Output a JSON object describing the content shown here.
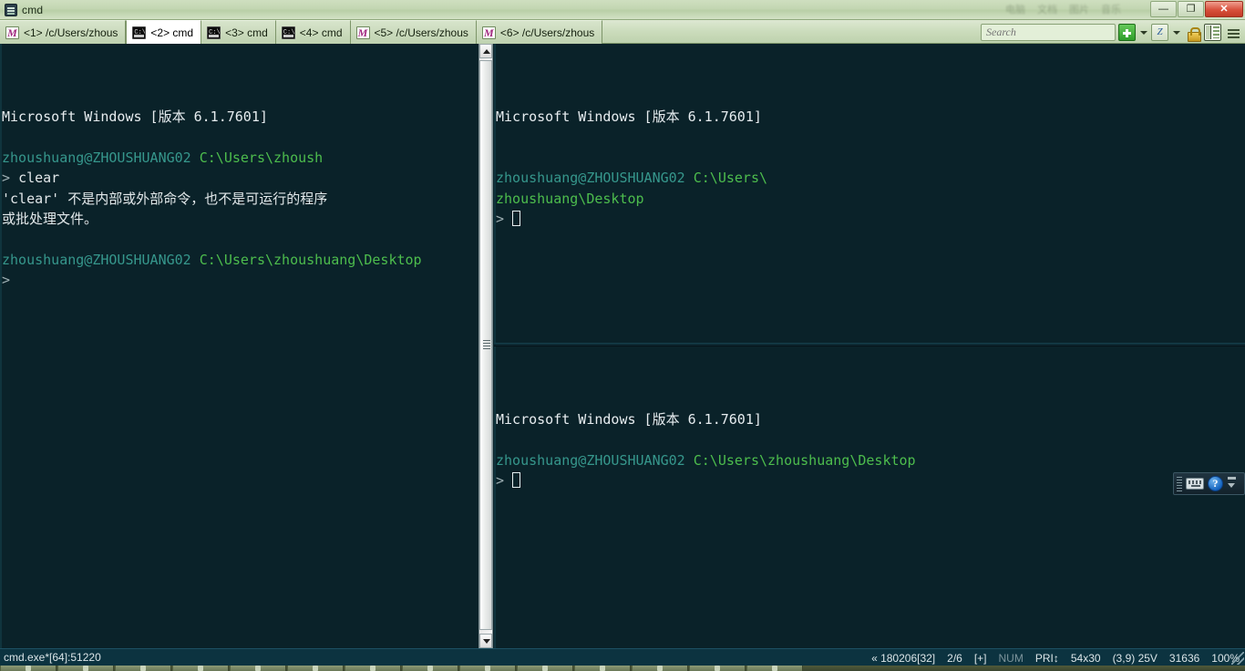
{
  "window": {
    "title": "cmd",
    "app_icon": "console-icon",
    "ghost_texts": [
      "电脑",
      "文档",
      "图片",
      "音乐"
    ],
    "controls": [
      {
        "name": "minimize-button",
        "glyph": "—"
      },
      {
        "name": "restore-button",
        "glyph": "❐"
      },
      {
        "name": "close-button",
        "glyph": "✕"
      }
    ]
  },
  "tabs": [
    {
      "label": "<1> /c/Users/zhous",
      "icon": "mintty-icon",
      "icon_glyph": "M",
      "active": false
    },
    {
      "label": "<2> cmd",
      "icon": "cmd-icon",
      "icon_glyph": "",
      "active": true
    },
    {
      "label": "<3> cmd",
      "icon": "cmd-icon",
      "icon_glyph": "",
      "active": false
    },
    {
      "label": "<4> cmd",
      "icon": "cmd-icon",
      "icon_glyph": "",
      "active": false
    },
    {
      "label": "<5> /c/Users/zhous",
      "icon": "mintty-icon",
      "icon_glyph": "M",
      "active": false
    },
    {
      "label": "<6> /c/Users/zhous",
      "icon": "mintty-icon",
      "icon_glyph": "M",
      "active": false
    }
  ],
  "toolbar": {
    "search_placeholder": "Search",
    "search_value": "",
    "search_icon": "magnifier-icon",
    "buttons": [
      {
        "name": "new-session-button",
        "icon": "green-plus-icon"
      },
      {
        "name": "new-session-dropdown",
        "icon": "chevron-down-icon"
      },
      {
        "name": "quake-mode-button",
        "icon": "z-square-icon",
        "glyph": "Z"
      },
      {
        "name": "quake-mode-dropdown",
        "icon": "chevron-down-icon"
      },
      {
        "name": "lock-button",
        "icon": "padlock-icon"
      },
      {
        "name": "toggle-panel-button",
        "icon": "split-panel-icon"
      },
      {
        "name": "main-menu-button",
        "icon": "hamburger-menu-icon"
      }
    ]
  },
  "panes": {
    "left": {
      "name": "terminal-pane-left",
      "lines": [
        [
          {
            "t": "Microsoft Windows [版本 6.1.7601]",
            "c": "head"
          }
        ],
        [],
        [
          {
            "t": "zhoushuang@ZHOUSHUANG02",
            "c": "user"
          },
          {
            "t": " ",
            "c": "out"
          },
          {
            "t": "C:\\Users\\zhoush",
            "c": "path"
          }
        ],
        [
          {
            "t": "> ",
            "c": "prompt"
          },
          {
            "t": "clear",
            "c": "out"
          }
        ],
        [
          {
            "t": "'clear' 不是内部或外部命令，也不是可运行的程序",
            "c": "out"
          }
        ],
        [
          {
            "t": "或批处理文件。",
            "c": "out"
          }
        ],
        [],
        [
          {
            "t": "zhoushuang@ZHOUSHUANG02",
            "c": "user"
          },
          {
            "t": " ",
            "c": "out"
          },
          {
            "t": "C:\\Users\\zhoushuang\\Desktop",
            "c": "path"
          }
        ],
        [
          {
            "t": ">",
            "c": "prompt"
          }
        ]
      ]
    },
    "top_right": {
      "name": "terminal-pane-top-right",
      "lines": [
        [
          {
            "t": "Microsoft Windows [版本 6.1.7601]",
            "c": "head"
          }
        ],
        [],
        [],
        [
          {
            "t": "zhoushuang@ZHOUSHUANG02",
            "c": "user"
          },
          {
            "t": " ",
            "c": "out"
          },
          {
            "t": "C:\\Users\\",
            "c": "path"
          }
        ],
        [
          {
            "t": "zhoushuang\\Desktop",
            "c": "path"
          }
        ],
        [
          {
            "t": "> ",
            "c": "prompt"
          },
          {
            "t": "",
            "c": "cursor"
          }
        ]
      ]
    },
    "bottom_right": {
      "name": "terminal-pane-bottom-right",
      "lines": [
        [
          {
            "t": "Microsoft Windows [版本 6.1.7601]",
            "c": "head"
          }
        ],
        [],
        [
          {
            "t": "zhoushuang@ZHOUSHUANG02",
            "c": "user"
          },
          {
            "t": " ",
            "c": "out"
          },
          {
            "t": "C:\\Users\\zhoushuang\\Desktop",
            "c": "path"
          }
        ],
        [
          {
            "t": "> ",
            "c": "prompt"
          },
          {
            "t": "",
            "c": "cursor"
          }
        ]
      ]
    }
  },
  "ime_widget": {
    "keyboard_icon": "keyboard-icon",
    "help_icon": "help-question-icon",
    "help_glyph": "?",
    "arrows_icon": "ime-arrows-icon"
  },
  "statusbar": {
    "left": "cmd.exe*[64]:51220",
    "items": [
      {
        "name": "status-date",
        "text": "« 180206[32]",
        "dim": false
      },
      {
        "name": "status-pane-count",
        "text": "2/6",
        "dim": false
      },
      {
        "name": "status-insert-mode",
        "text": "[+]",
        "dim": false
      },
      {
        "name": "status-numlock",
        "text": "NUM",
        "dim": true
      },
      {
        "name": "status-priority",
        "text": "PRI↕",
        "dim": false
      },
      {
        "name": "status-size",
        "text": "54x30",
        "dim": false
      },
      {
        "name": "status-cursor-pos",
        "text": "(3,9) 25V",
        "dim": false
      },
      {
        "name": "status-memory",
        "text": "31636",
        "dim": false
      },
      {
        "name": "status-zoom",
        "text": "100%",
        "dim": false
      }
    ]
  },
  "colors": {
    "terminal_bg": "#0a2229",
    "user": "#36978c",
    "path": "#4dbd4d",
    "output": "#e2e8ea",
    "statusbar_bg": "#0c3340",
    "titlebar_bg": "#c3d6b2",
    "close_button": "#d8503c"
  },
  "taskbar": {
    "item_count": 14
  }
}
